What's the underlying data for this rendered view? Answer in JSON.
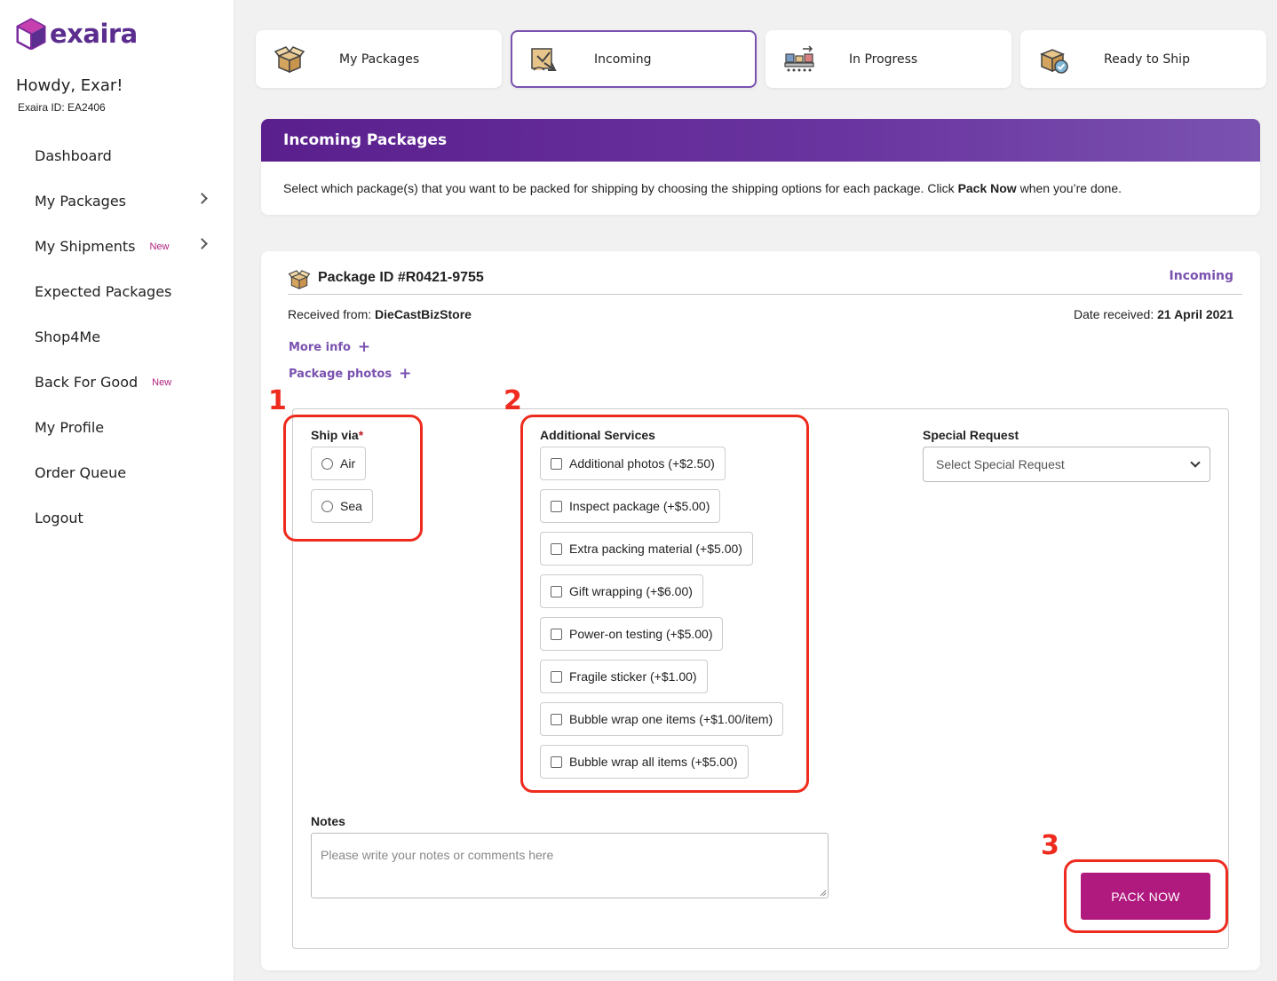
{
  "brand": {
    "name": "exaira",
    "color": "#5b2d8e"
  },
  "user": {
    "greeting": "Howdy, Exar!",
    "id_label": "Exaira ID: EA2406"
  },
  "nav": {
    "items": [
      {
        "label": "Dashboard",
        "badge": "",
        "has_chevron": false
      },
      {
        "label": "My Packages",
        "badge": "",
        "has_chevron": true
      },
      {
        "label": "My Shipments",
        "badge": "New",
        "has_chevron": true
      },
      {
        "label": "Expected Packages",
        "badge": "",
        "has_chevron": false
      },
      {
        "label": "Shop4Me",
        "badge": "",
        "has_chevron": false
      },
      {
        "label": "Back For Good",
        "badge": "New",
        "has_chevron": false
      },
      {
        "label": "My Profile",
        "badge": "",
        "has_chevron": false
      },
      {
        "label": "Order Queue",
        "badge": "",
        "has_chevron": false
      },
      {
        "label": "Logout",
        "badge": "",
        "has_chevron": false
      }
    ]
  },
  "tabs": [
    {
      "label": "My Packages",
      "icon": "open-box-icon",
      "active": false
    },
    {
      "label": "Incoming",
      "icon": "incoming-box-icon",
      "active": true
    },
    {
      "label": "In Progress",
      "icon": "conveyor-icon",
      "active": false
    },
    {
      "label": "Ready to Ship",
      "icon": "checked-box-icon",
      "active": false
    }
  ],
  "intro": {
    "title": "Incoming Packages",
    "text_before": "Select which package(s) that you want to be packed for shipping by choosing the shipping options for each package. Click ",
    "text_bold": "Pack Now",
    "text_after": " when you’re done."
  },
  "package": {
    "id_label": "Package ID #R0421-9755",
    "status": "Incoming",
    "received_from_label": "Received from: ",
    "received_from_value": "DieCastBizStore",
    "date_label": "Date received: ",
    "date_value": "21 April 2021",
    "more_info": "More info",
    "package_photos": "Package photos"
  },
  "form": {
    "ship_via": {
      "label": "Ship via",
      "required_mark": "*",
      "options": [
        "Air",
        "Sea"
      ]
    },
    "additional_services": {
      "label": "Additional Services",
      "options": [
        "Additional photos (+$2.50)",
        "Inspect package (+$5.00)",
        "Extra packing material (+$5.00)",
        "Gift wrapping (+$6.00)",
        "Power-on testing (+$5.00)",
        "Fragile sticker (+$1.00)",
        "Bubble wrap one items (+$1.00/item)",
        "Bubble wrap all items (+$5.00)"
      ]
    },
    "special_request": {
      "label": "Special Request",
      "selected": "Select Special Request"
    },
    "notes": {
      "label": "Notes",
      "placeholder": "Please write your notes or comments here"
    },
    "submit_label": "PACK NOW"
  },
  "annotations": {
    "one": "1",
    "two": "2",
    "three": "3",
    "color": "#ee2b1e"
  },
  "colors": {
    "accent": "#7a52b0",
    "button": "#b0197e",
    "header_gradient_start": "#5a1f8d"
  }
}
